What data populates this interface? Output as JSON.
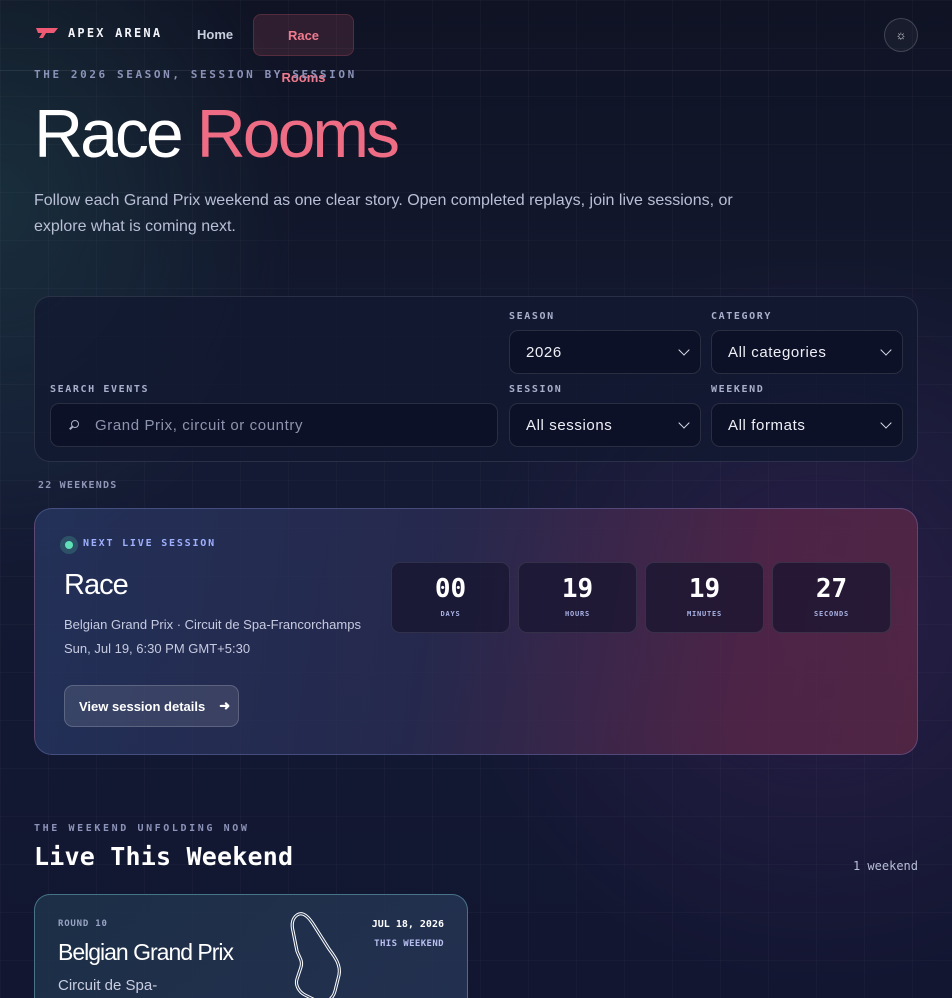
{
  "nav": {
    "brand": "APEX ARENA",
    "links": [
      {
        "label": "Home"
      },
      {
        "label": "Race Rooms",
        "active": true
      }
    ],
    "theme_icon": "sun-icon"
  },
  "hero": {
    "eyebrow": "THE 2026 SEASON, SESSION BY SESSION",
    "title_part1": "Race",
    "title_part2": "Rooms",
    "description": "Follow each Grand Prix weekend as one clear story. Open completed replays, join live sessions, or explore what is coming next."
  },
  "filters": {
    "search_label": "SEARCH EVENTS",
    "search_placeholder": "Grand Prix, circuit or country",
    "season_label": "SEASON",
    "season_value": "2026",
    "category_label": "CATEGORY",
    "category_value": "All categories",
    "session_label": "SESSION",
    "session_value": "All sessions",
    "weekend_label": "WEEKEND",
    "weekend_value": "All formats"
  },
  "results_count": "22 WEEKENDS",
  "next_session": {
    "eyebrow": "NEXT LIVE SESSION",
    "title": "Race",
    "event": "Belgian Grand Prix · Circuit de Spa-Francorchamps",
    "time": "Sun, Jul 19, 6:30 PM GMT+5:30",
    "button_label": "View session details",
    "button_icon": "arrow-right-icon",
    "countdown": {
      "days": "00",
      "days_label": "DAYS",
      "hours": "19",
      "hours_label": "HOURS",
      "minutes": "19",
      "minutes_label": "MINUTES",
      "seconds": "27",
      "seconds_label": "SECONDS"
    }
  },
  "live_section": {
    "eyebrow": "THE WEEKEND UNFOLDING NOW",
    "title": "Live This Weekend",
    "count": "1 weekend",
    "events": [
      {
        "round": "ROUND 10",
        "name": "Belgian Grand Prix",
        "circuit": "Circuit de Spa-",
        "date": "JUL 18, 2026",
        "tag": "THIS WEEKEND"
      }
    ]
  },
  "colors": {
    "accent": "#ee6d84",
    "live": "#5fe0b8",
    "eyebrow": "#8c93b8"
  }
}
